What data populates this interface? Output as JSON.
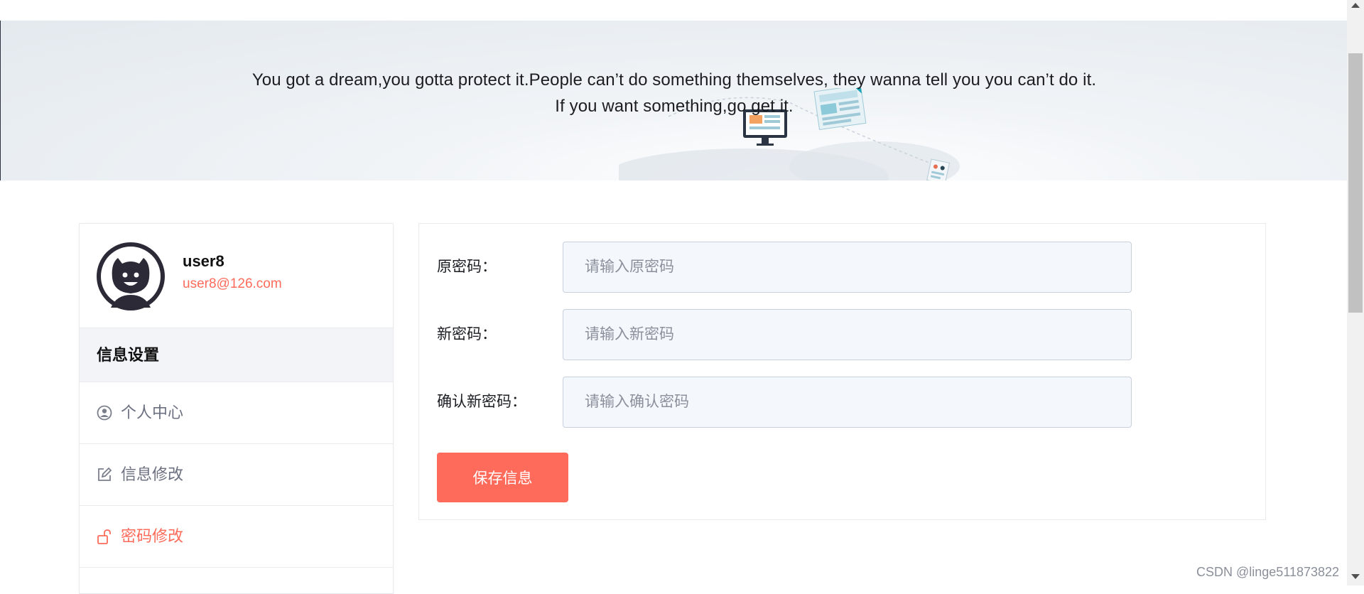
{
  "banner": {
    "line1": "You got a dream,you gotta protect it.People can’t do something themselves, they wanna tell you you can’t do it.",
    "line2": "If you want something,go get it."
  },
  "user": {
    "name": "user8",
    "email": "user8@126.com"
  },
  "sidebar": {
    "heading": "信息设置",
    "items": [
      {
        "label": "个人中心",
        "icon": "user-circle-icon"
      },
      {
        "label": "信息修改",
        "icon": "edit-icon"
      },
      {
        "label": "密码修改",
        "icon": "unlock-icon",
        "active": true
      }
    ]
  },
  "form": {
    "old_password": {
      "label": "原密码：",
      "placeholder": "请输入原密码"
    },
    "new_password": {
      "label": "新密码：",
      "placeholder": "请输入新密码"
    },
    "confirm_password": {
      "label": "确认新密码：",
      "placeholder": "请输入确认密码"
    },
    "save_label": "保存信息"
  },
  "colors": {
    "accent": "#ff6b5b",
    "muted_text": "#6b7080",
    "input_bg": "#f4f7fb"
  },
  "watermark": "CSDN @linge511873822"
}
